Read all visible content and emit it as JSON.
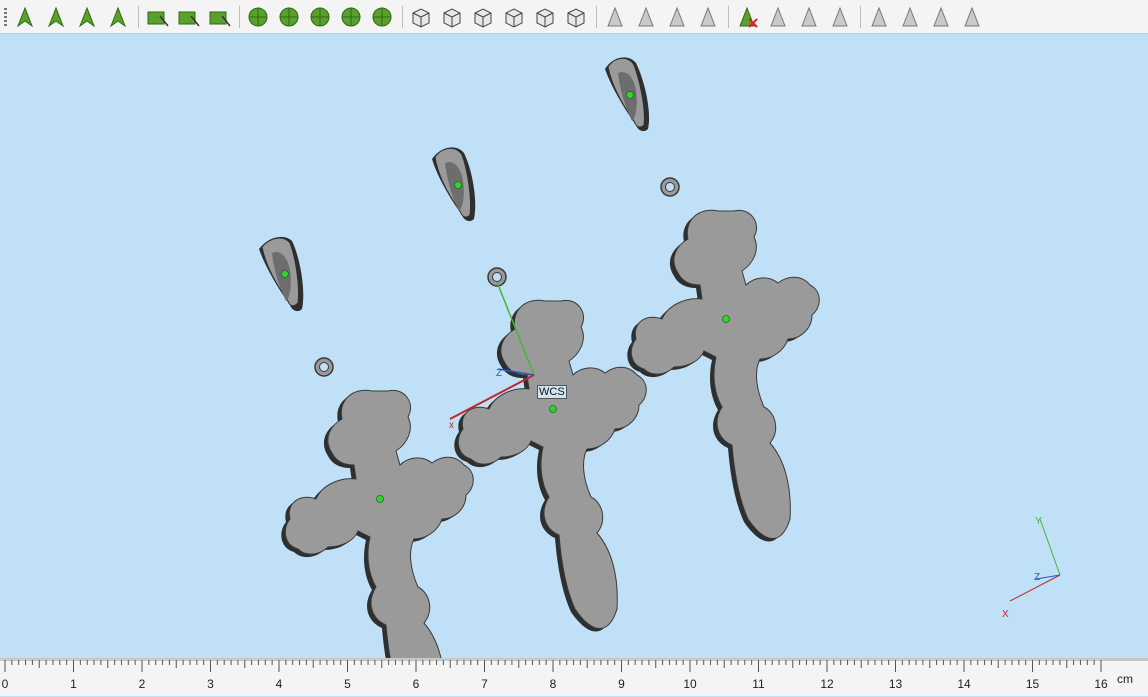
{
  "toolbar": {
    "groups": [
      [
        "select-arrow-icon",
        "select-face-icon",
        "select-edge-icon",
        "select-solid-icon"
      ],
      [
        "draw-rectangle-icon",
        "draw-nodes-icon",
        "draw-curve-icon"
      ],
      [
        "mesh-face-icon",
        "mesh-nodes-icon",
        "mesh-pattern-icon",
        "mesh-sphere-icon",
        "mesh-cut-icon"
      ],
      [
        "view-front-icon",
        "view-top-icon",
        "view-shaded-icon",
        "view-wireframe-icon",
        "view-section-icon",
        "view-iso-icon"
      ],
      [
        "snap-arrow-icon",
        "snap-face-icon",
        "snap-edge-icon",
        "snap-globe-icon"
      ],
      [
        "delete-selection-icon",
        "hide-face-icon",
        "copy-face-icon",
        "hide-edge-icon"
      ],
      [
        "show-hidden-icon",
        "show-info-icon",
        "show-visibility-icon",
        "show-plane-icon"
      ]
    ]
  },
  "viewport": {
    "wcs_label": "WCS",
    "triad_labels": {
      "y": "Y",
      "z": "Z",
      "x": "X"
    },
    "main_axis_labels": {
      "z": "Z",
      "x": "x"
    },
    "colors": {
      "background": "#bfe0f7",
      "part": "#9a9a9a",
      "edge": "#2f2f2f",
      "x_axis": "#c0282a",
      "y_axis": "#3fb83a",
      "z_axis": "#2a56c8",
      "marker": "#33d133"
    }
  },
  "ruler": {
    "labels": [
      "0",
      "1",
      "2",
      "3",
      "4",
      "5",
      "6",
      "7",
      "8",
      "9",
      "10",
      "11",
      "12",
      "13",
      "14",
      "15",
      "16"
    ],
    "unit": "cm"
  }
}
